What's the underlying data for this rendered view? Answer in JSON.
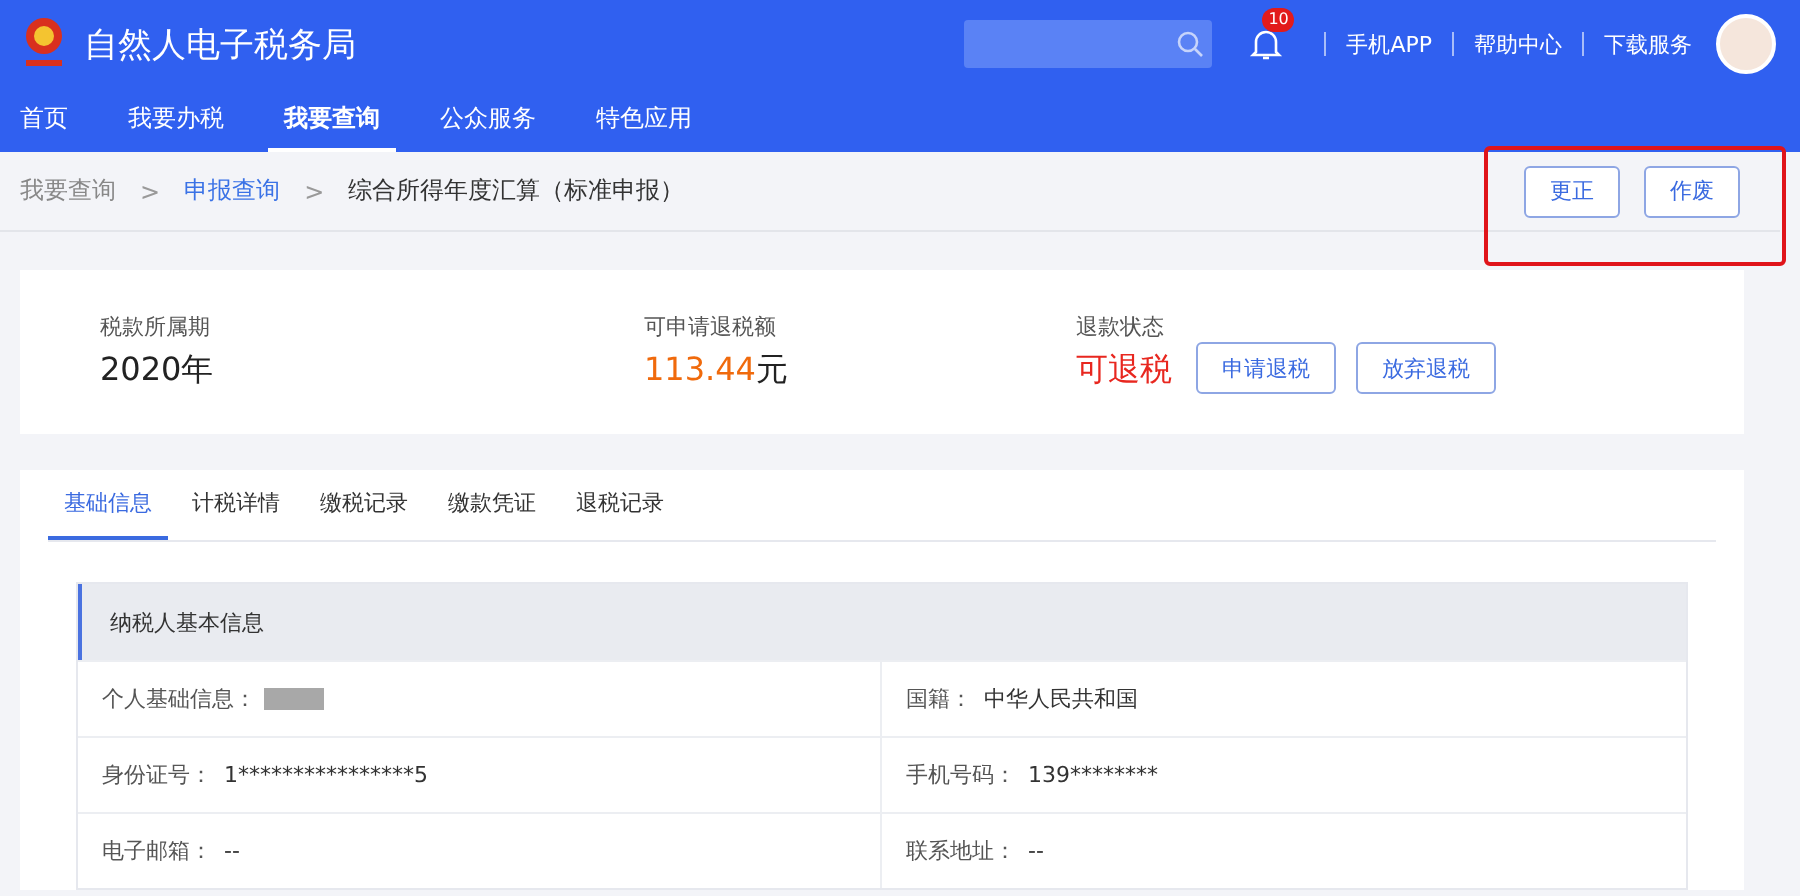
{
  "header": {
    "title": "自然人电子税务局",
    "notifications": "10",
    "links": [
      "手机APP",
      "帮助中心",
      "下载服务"
    ]
  },
  "nav": [
    {
      "label": "首页",
      "selected": false
    },
    {
      "label": "我要办税",
      "selected": false
    },
    {
      "label": "我要查询",
      "selected": true
    },
    {
      "label": "公众服务",
      "selected": false
    },
    {
      "label": "特色应用",
      "selected": false
    }
  ],
  "breadcrumb": [
    {
      "label": "我要查询",
      "kind": "plain"
    },
    {
      "label": ">",
      "kind": "separator"
    },
    {
      "label": "申报查询",
      "kind": "link"
    },
    {
      "label": ">",
      "kind": "separator"
    },
    {
      "label": "综合所得年度汇算（标准申报）",
      "kind": "current"
    }
  ],
  "actions": [
    "更正",
    "作废"
  ],
  "summary": {
    "period_label": "税款所属期",
    "period": "2020年",
    "amount_label": "可申请退税额",
    "amount": "113.44",
    "amount_unit": "元",
    "status_label": "退款状态",
    "status": "可退税",
    "buttons": [
      "申请退税",
      "放弃退税"
    ]
  },
  "tabs": [
    {
      "label": "基础信息",
      "selected": true
    },
    {
      "label": "计税详情",
      "selected": false
    },
    {
      "label": "缴税记录",
      "selected": false
    },
    {
      "label": "缴款凭证",
      "selected": false
    },
    {
      "label": "退税记录",
      "selected": false
    }
  ],
  "section_title": "纳税人基本信息",
  "fields": [
    {
      "label": "个人基础信息：",
      "redacted": true
    },
    {
      "label": "国籍：",
      "value": "中华人民共和国",
      "redacted": false
    },
    {
      "label": "身份证号：",
      "value": "1****************5",
      "redacted": false
    },
    {
      "label": "手机号码：",
      "value": "139********",
      "redacted": false
    },
    {
      "label": "电子邮箱：",
      "value": "--",
      "redacted": false
    },
    {
      "label": "联系地址：",
      "value": "--",
      "redacted": false
    }
  ]
}
